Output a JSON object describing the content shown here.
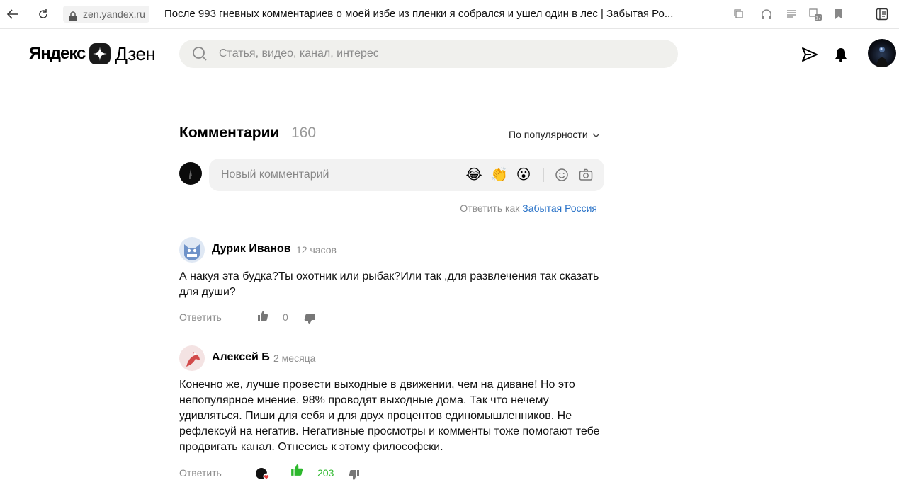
{
  "browser": {
    "url": "zen.yandex.ru",
    "page_title": "После 993 гневных комментариев о моей избе из пленки я собрался и ушел один в лес | Забытая Ро..."
  },
  "header": {
    "logo_yandex": "Яндекс",
    "logo_dzen": "Дзен",
    "search_placeholder": "Статья, видео, канал, интерес"
  },
  "comments_section": {
    "title": "Комментарии",
    "count": "160",
    "sort_label": "По популярности",
    "new_comment_placeholder": "Новый комментарий",
    "reaction_emojis": [
      "😂",
      "👏",
      "😮"
    ],
    "reply_as_prefix": "Ответить как",
    "reply_as_channel": "Забытая Россия"
  },
  "comments": [
    {
      "author": "Дурик Иванов",
      "time": "12 часов",
      "text": "А накуя эта будка?Ты охотник или рыбак?Или так ,для развлечения так сказать для души?",
      "reply_label": "Ответить",
      "score": "0",
      "liked": false
    },
    {
      "author": "Алексей Б",
      "time": "2 месяца",
      "text": "Конечно же, лучше провести выходные в движении, чем на диване! Но это непопулярное мнение. 98% проводят выходные дома. Так что нечему удивляться. Пиши для себя и для двух процентов единомышленников. Не рефлексуй на негатив. Негативные просмотры и комменты тоже помогают тебе продвигать канал. Отнесись к этому философски.",
      "reply_label": "Ответить",
      "score": "203",
      "liked": true
    }
  ],
  "colors": {
    "link_blue": "#2771c7",
    "like_green": "#2db82d",
    "muted_gray": "#8c8c8c"
  }
}
